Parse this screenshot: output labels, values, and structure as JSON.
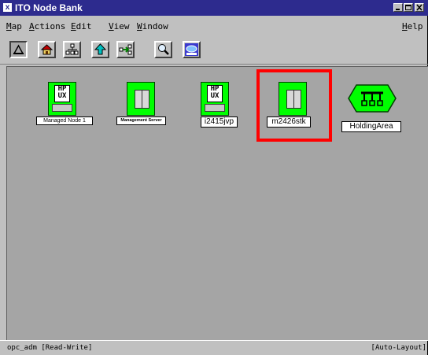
{
  "window": {
    "icon_glyph": "x",
    "title": "ITO Node Bank"
  },
  "menu": {
    "items": [
      {
        "first": "M",
        "rest": "ap"
      },
      {
        "first": "A",
        "rest": "ctions"
      },
      {
        "first": "E",
        "rest": "dit"
      },
      {
        "first": "V",
        "rest": "iew"
      },
      {
        "first": "W",
        "rest": "indow"
      }
    ],
    "help": {
      "first": "H",
      "rest": "elp"
    }
  },
  "toolbar": {
    "buttons": [
      "select-icon",
      "home-icon",
      "hierarchy-icon",
      "up-icon",
      "connect-icon",
      "search-icon",
      "hp-openview-icon"
    ]
  },
  "nodes": [
    {
      "label": "Managed Node 1",
      "kind": "hpux",
      "hp": "HP",
      "ux": "UX"
    },
    {
      "label": "Management Server",
      "kind": "server"
    },
    {
      "label": "i2415jvp",
      "kind": "hpux",
      "hp": "HP",
      "ux": "UX"
    },
    {
      "label": "m2426stk",
      "kind": "server",
      "selected": true
    },
    {
      "label": "HoldingArea",
      "kind": "holding-area"
    }
  ],
  "status": {
    "left": "opc_adm [Read-Write]",
    "right": "[Auto-Layout]"
  },
  "colors": {
    "node_ok": "#00ff00",
    "selection": "#ff0000",
    "titlebar": "#2d2b8e"
  }
}
